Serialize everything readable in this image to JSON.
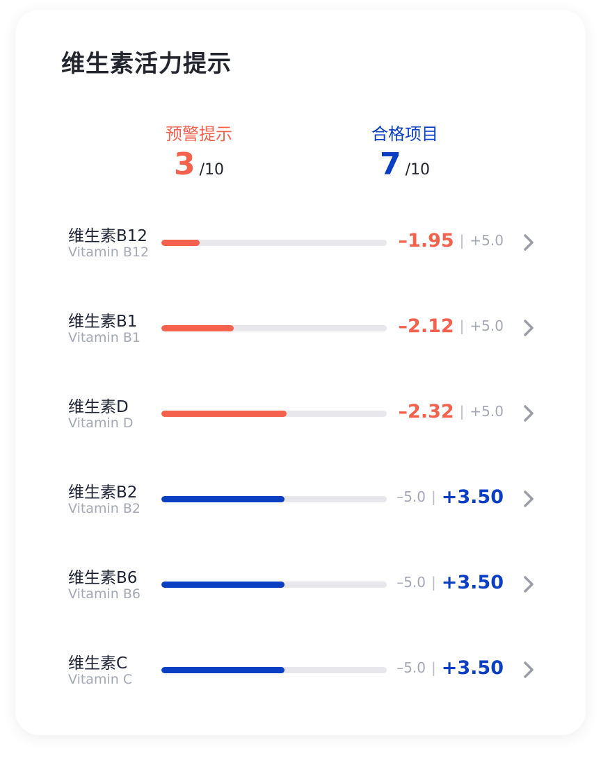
{
  "header": {
    "title": "维生素活力提示"
  },
  "summary": {
    "warning": {
      "label": "预警提示",
      "count": "3",
      "total": "/10"
    },
    "qualified": {
      "label": "合格项目",
      "count": "7",
      "total": "/10"
    }
  },
  "colors": {
    "warning": "#f4614d",
    "qualified": "#0a3fc4",
    "track": "#e8e8ec"
  },
  "vitamins": [
    {
      "name_cn": "维生素B12",
      "name_en": "Vitamin B12",
      "status": "negative",
      "value": "–1.95",
      "min": "–5.0",
      "max": "+5.0",
      "bar_fraction": 0.17
    },
    {
      "name_cn": "维生素B1",
      "name_en": "Vitamin B1",
      "status": "negative",
      "value": "–2.12",
      "min": "–5.0",
      "max": "+5.0",
      "bar_fraction": 0.32
    },
    {
      "name_cn": "维生素D",
      "name_en": "Vitamin D",
      "status": "negative",
      "value": "–2.32",
      "min": "–5.0",
      "max": "+5.0",
      "bar_fraction": 0.555
    },
    {
      "name_cn": "维生素B2",
      "name_en": "Vitamin B2",
      "status": "positive",
      "value": "+3.50",
      "min": "–5.0",
      "max": "+5.0",
      "bar_fraction": 0.545
    },
    {
      "name_cn": "维生素B6",
      "name_en": "Vitamin B6",
      "status": "positive",
      "value": "+3.50",
      "min": "–5.0",
      "max": "+5.0",
      "bar_fraction": 0.545
    },
    {
      "name_cn": "维生素C",
      "name_en": "Vitamin C",
      "status": "positive",
      "value": "+3.50",
      "min": "–5.0",
      "max": "+5.0",
      "bar_fraction": 0.545
    }
  ],
  "separator": "|",
  "icons": {
    "row_action": "chevron-right-icon"
  }
}
